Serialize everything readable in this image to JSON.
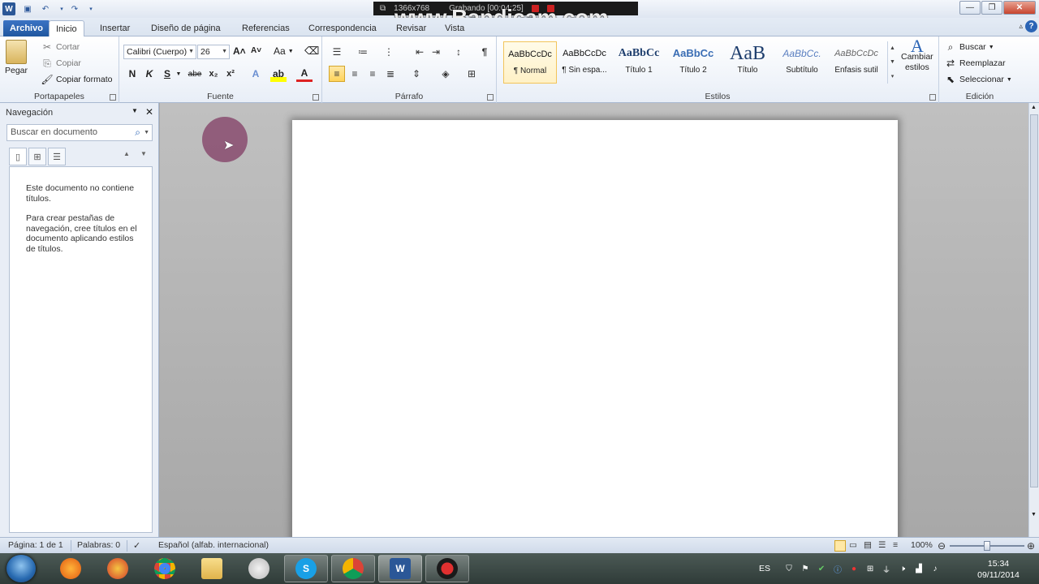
{
  "recorder": {
    "resolution": "1366x768",
    "status": "Grabando [00:04:25]",
    "watermark": "www.Bandicam.com"
  },
  "tabs": [
    {
      "label": "Archivo"
    },
    {
      "label": "Inicio"
    },
    {
      "label": "Insertar"
    },
    {
      "label": "Diseño de página"
    },
    {
      "label": "Referencias"
    },
    {
      "label": "Correspondencia"
    },
    {
      "label": "Revisar"
    },
    {
      "label": "Vista"
    }
  ],
  "ribbon": {
    "clipboard": {
      "paste": "Pegar",
      "cut": "Cortar",
      "copy": "Copiar",
      "format_painter": "Copiar formato",
      "label": "Portapapeles"
    },
    "font": {
      "family": "Calibri (Cuerpo)",
      "size": "26",
      "bold": "N",
      "italic": "K",
      "underline": "S",
      "strike": "abe",
      "subscript": "x₂",
      "superscript": "x²",
      "change_case": "Aa",
      "label": "Fuente"
    },
    "paragraph": {
      "label": "Párrafo",
      "pilcrow": "¶"
    },
    "styles": {
      "items": [
        {
          "sample": "AaBbCcDc",
          "name": "¶ Normal"
        },
        {
          "sample": "AaBbCcDc",
          "name": "¶ Sin espa..."
        },
        {
          "sample": "AaBbCc",
          "name": "Título 1"
        },
        {
          "sample": "AaBbCc",
          "name": "Título 2"
        },
        {
          "sample": "AaB",
          "name": "Título"
        },
        {
          "sample": "AaBbCc.",
          "name": "Subtítulo"
        },
        {
          "sample": "AaBbCcDc",
          "name": "Énfasis sutil"
        }
      ],
      "change_line1": "Cambiar",
      "change_line2": "estilos",
      "label": "Estilos"
    },
    "editing": {
      "find": "Buscar",
      "replace": "Reemplazar",
      "select": "Seleccionar",
      "label": "Edición"
    }
  },
  "navigation": {
    "title": "Navegación",
    "search_placeholder": "Buscar en documento",
    "message1": "Este documento no contiene títulos.",
    "message2": "Para crear pestañas de navegación, cree títulos en el documento aplicando estilos de títulos."
  },
  "status": {
    "page": "Página: 1 de 1",
    "words": "Palabras: 0",
    "language": "Español (alfab. internacional)",
    "zoom": "100%",
    "zoom_level": 1.0
  },
  "taskbar": {
    "language": "ES",
    "time": "15:34",
    "date": "09/11/2014",
    "apps": [
      "firefox-icon",
      "paint-icon",
      "chrome-icon",
      "explorer-icon",
      "paint-palette-icon",
      "skype-icon",
      "chrome-icon",
      "word-icon",
      "bandicam-icon"
    ]
  },
  "colors": {
    "file_tab": "#2a61b0",
    "selected_style": "#f2c45a",
    "taskbar": "#3a4744",
    "cursor_highlight": "#8c3d6a"
  }
}
